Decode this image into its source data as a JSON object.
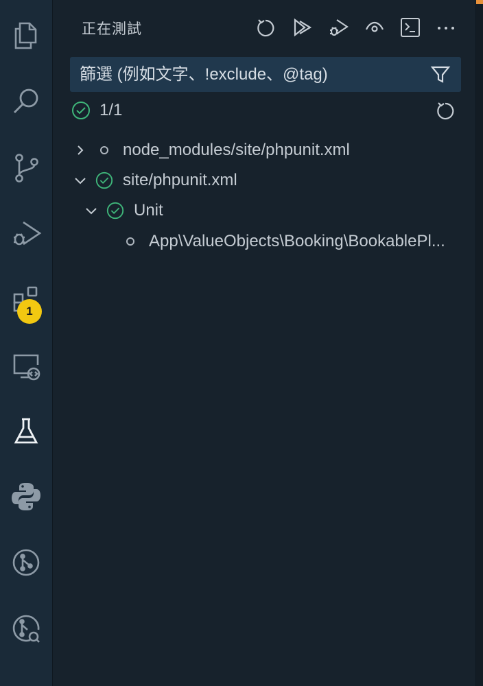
{
  "activity_bar": {
    "items": [
      {
        "name": "explorer-icon"
      },
      {
        "name": "search-icon"
      },
      {
        "name": "source-control-icon"
      },
      {
        "name": "run-debug-icon"
      },
      {
        "name": "extensions-icon",
        "badge": "1"
      },
      {
        "name": "remote-explorer-icon"
      },
      {
        "name": "testing-icon",
        "active": true
      },
      {
        "name": "python-icon"
      },
      {
        "name": "git-graph-icon"
      },
      {
        "name": "git-lens-icon"
      }
    ]
  },
  "testing": {
    "title": "正在測試",
    "toolbar": [
      "refresh-icon",
      "run-all-icon",
      "debug-all-icon",
      "watch-icon",
      "terminal-icon",
      "more-icon"
    ],
    "filter": {
      "placeholder": "篩選 (例如文字、!exclude、@tag)"
    },
    "summary": {
      "count": "1/1"
    },
    "tree": [
      {
        "label": "node_modules/site/phpunit.xml",
        "expanded": false,
        "status": "unset",
        "level": 0
      },
      {
        "label": "site/phpunit.xml",
        "expanded": true,
        "status": "passed",
        "level": 0
      },
      {
        "label": "Unit",
        "expanded": true,
        "status": "passed",
        "level": 1
      },
      {
        "label": "App\\ValueObjects\\Booking\\BookablePl...",
        "status": "unset",
        "level": 2
      }
    ]
  },
  "colors": {
    "accent_pass": "#3fb67a",
    "badge": "#f2c811",
    "background": "#17222c"
  }
}
